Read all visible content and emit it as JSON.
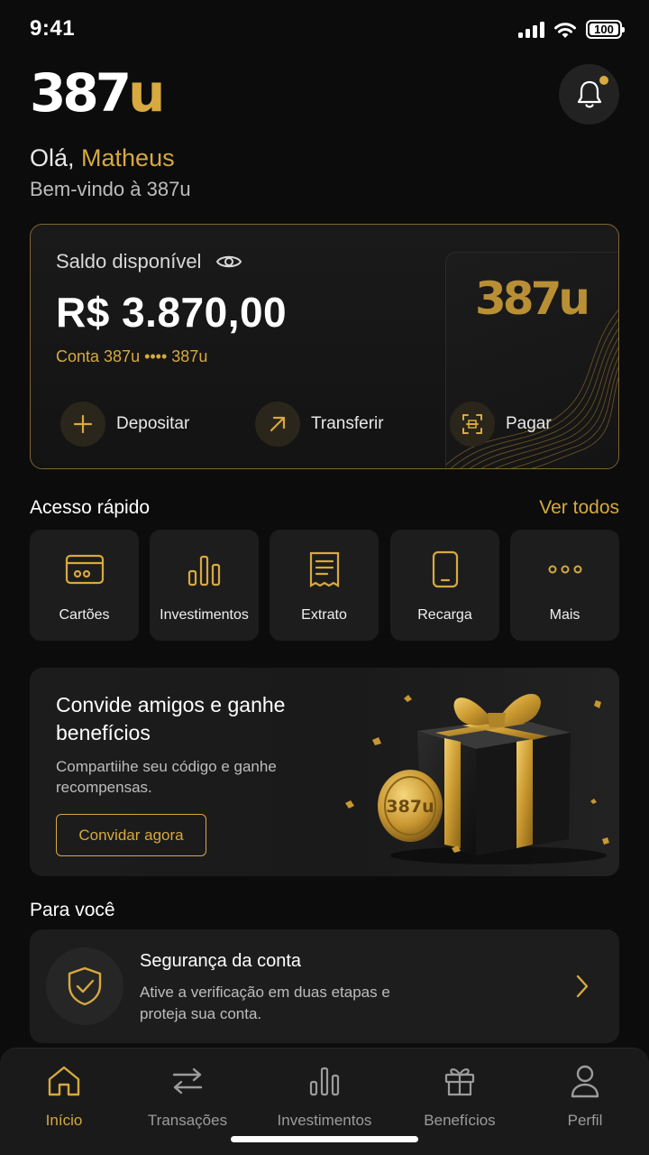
{
  "status_bar": {
    "time": "9:41",
    "battery": "100"
  },
  "header": {
    "logo_main": "387",
    "logo_accent": "u"
  },
  "greeting": {
    "prefix": "Olá, ",
    "name": "Matheus",
    "subtitle": "Bem-vindo à 387u"
  },
  "balance_card": {
    "label": "Saldo disponível",
    "amount": "R$ 3.870,00",
    "account": "Conta 387u •••• 387u",
    "card_logo": "387u",
    "actions": [
      {
        "label": "Depositar",
        "icon": "plus-icon"
      },
      {
        "label": "Transferir",
        "icon": "arrow-up-right-icon"
      },
      {
        "label": "Pagar",
        "icon": "scan-icon"
      }
    ]
  },
  "quick_access": {
    "title": "Acesso rápido",
    "see_all": "Ver todos",
    "items": [
      {
        "label": "Cartões",
        "icon": "card-icon"
      },
      {
        "label": "Investimentos",
        "icon": "bar-chart-icon"
      },
      {
        "label": "Extrato",
        "icon": "receipt-icon"
      },
      {
        "label": "Recarga",
        "icon": "phone-icon"
      },
      {
        "label": "Mais",
        "icon": "more-icon"
      }
    ]
  },
  "promo": {
    "title": "Convide amigos e ganhe benefícios",
    "subtitle": "Compartiihe seu código e ganhe recompensas.",
    "button": "Convidar agora",
    "coin_text": "387u"
  },
  "for_you": {
    "title": "Para você",
    "card": {
      "title": "Segurança da conta",
      "description": "Ative a verificação em duas etapas e proteja sua conta.",
      "icon": "shield-check-icon"
    }
  },
  "bottom_nav": [
    {
      "label": "Início",
      "icon": "home-icon",
      "active": true
    },
    {
      "label": "Transações",
      "icon": "transfer-icon",
      "active": false
    },
    {
      "label": "Investimentos",
      "icon": "bar-chart-icon",
      "active": false
    },
    {
      "label": "Benefícios",
      "icon": "gift-icon",
      "active": false
    },
    {
      "label": "Perfil",
      "icon": "user-icon",
      "active": false
    }
  ],
  "colors": {
    "accent": "#d7a93f",
    "background": "#0c0c0c",
    "surface": "#1d1d1d"
  }
}
